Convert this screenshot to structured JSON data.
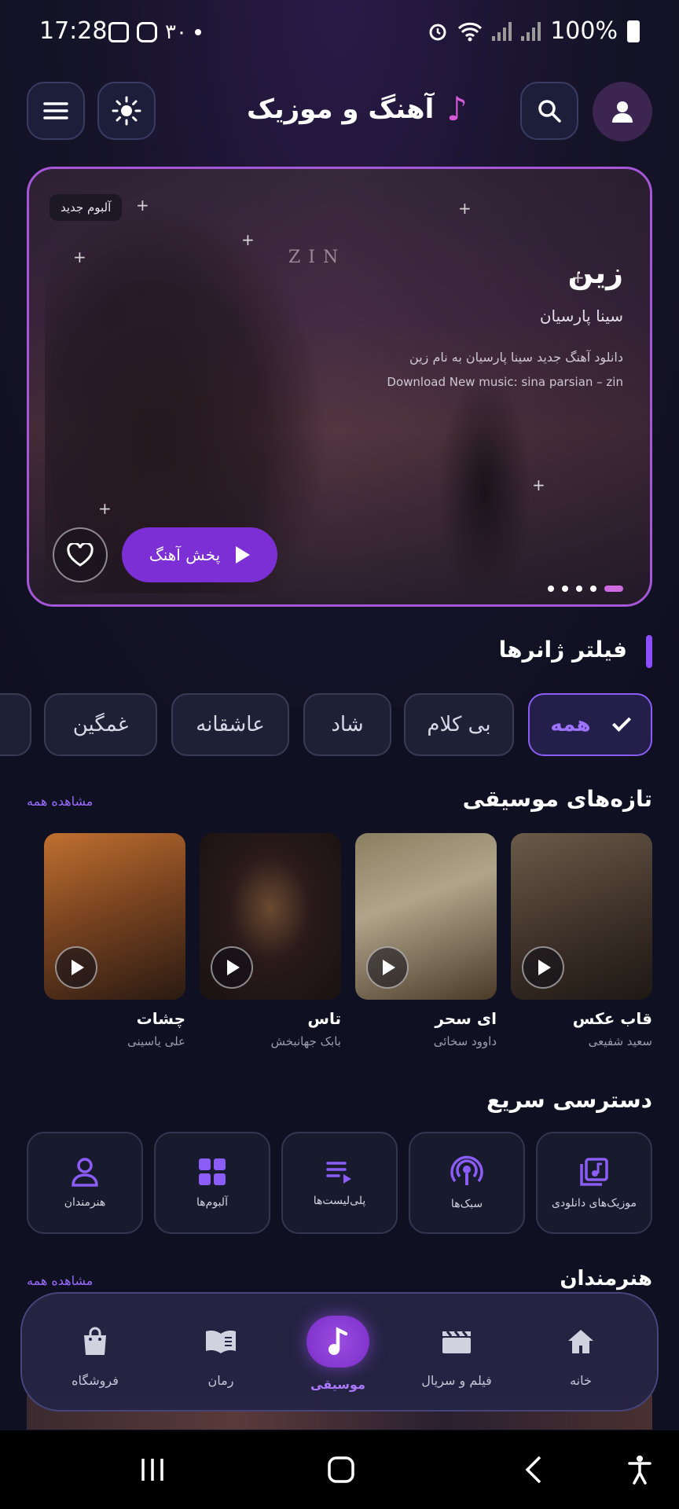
{
  "status_bar": {
    "time": "17:28",
    "temp": "۳۰",
    "battery": "100%"
  },
  "header": {
    "title": "آهنگ و موزیک"
  },
  "hero": {
    "badge": "آلبوم جدید",
    "title": "زین",
    "artist": "سینا پارسیان",
    "description": "دانلود آهنگ جدید سینا پارسیان به نام زین",
    "description_en": "Download New music: sina parsian – zin",
    "play_label": "پخش آهنگ",
    "art_text": "ZIN",
    "slide_count": 5,
    "active_slide": 1
  },
  "genres": {
    "title": "فیلتر ژانرها",
    "chips": [
      "همه",
      "بی کلام",
      "شاد",
      "عاشقانه",
      "غمگین"
    ]
  },
  "new_music": {
    "title": "تازه‌های موسیقی",
    "see_all": "مشاهده همه",
    "items": [
      {
        "name": "قاب عکس",
        "artist": "سعید شفیعی",
        "color": "#5a4a3a"
      },
      {
        "name": "ای سحر",
        "artist": "داوود سخائی",
        "color": "#7a6a50"
      },
      {
        "name": "تاس",
        "artist": "بابک جهانبخش",
        "color": "#3a2a2a"
      },
      {
        "name": "چشات",
        "artist": "علی یاسینی",
        "color": "#8a5a30"
      }
    ]
  },
  "quick_access": {
    "title": "دسترسی سریع",
    "items": [
      "موزیک‌های دانلودی",
      "سبک‌ها",
      "پلی‌لیست‌ها",
      "آلبوم‌ها",
      "هنرمندان"
    ]
  },
  "artists": {
    "title": "هنرمندان",
    "see_all": "مشاهده همه"
  },
  "bottom_nav": {
    "items": [
      "خانه",
      "فیلم و سریال",
      "موسیقی",
      "رمان",
      "فروشگاه"
    ],
    "active": "موسیقی"
  },
  "colors": {
    "accent": "#7b2fd4",
    "accent_light": "#9c73ff",
    "background": "#0f1022"
  }
}
